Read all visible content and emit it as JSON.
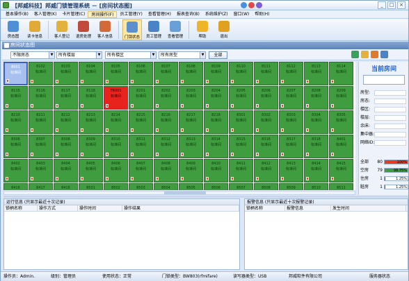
{
  "window": {
    "title": "【邦威科技】邦威门锁管理系统 － [房间状态图]"
  },
  "menu": {
    "items": [
      {
        "label": "基本操作(B)"
      },
      {
        "label": "客人管理(K)"
      },
      {
        "label": "卡片管理(C)"
      },
      {
        "label": "房间操作(F)"
      },
      {
        "label": "员工管理(Y)"
      },
      {
        "label": "查看管理(H)"
      },
      {
        "label": "报表查询(B)"
      },
      {
        "label": "系统维护(Z)"
      },
      {
        "label": "窗口(W)"
      },
      {
        "label": "帮助(H)"
      }
    ]
  },
  "toolbar": {
    "buttons": [
      {
        "label": "房态图",
        "icon": "room-map-icon",
        "color": "#4f8fd6"
      },
      {
        "label": "读卡信息",
        "icon": "card-read-icon",
        "color": "#e0a93a"
      },
      {
        "label": "客人登记",
        "icon": "guest-checkin-icon",
        "color": "#e3b23c"
      },
      {
        "label": "退房处理",
        "icon": "checkout-icon",
        "color": "#c24a3a"
      },
      {
        "label": "客人信息",
        "icon": "guest-info-icon",
        "color": "#d36a3a"
      },
      {
        "label": "门锁状态",
        "icon": "lock-status-icon",
        "color": "#5c8fce"
      },
      {
        "label": "员工管理",
        "icon": "staff-icon",
        "color": "#4a84c6"
      },
      {
        "label": "查看管理",
        "icon": "view-manage-icon",
        "color": "#6aa0d8"
      },
      {
        "label": "帮助",
        "icon": "help-icon",
        "color": "#f0b428"
      },
      {
        "label": "退出",
        "icon": "exit-icon",
        "color": "#e0a020"
      }
    ]
  },
  "panel": {
    "title": "房间状态图"
  },
  "filters": {
    "lock_type": "不限房态",
    "floor": "所有楼层",
    "building": "所有楼区",
    "room_type": "所有房型",
    "all_button": "全部"
  },
  "rooms": [
    {
      "no": "8001",
      "status": "标准间",
      "state": "selected"
    },
    {
      "no": "8102",
      "status": "标准间"
    },
    {
      "no": "8103",
      "status": "标准间"
    },
    {
      "no": "8104",
      "status": "标准间"
    },
    {
      "no": "8105",
      "status": "标准间"
    },
    {
      "no": "8106",
      "status": "标准间"
    },
    {
      "no": "8107",
      "status": "标准间"
    },
    {
      "no": "8108",
      "status": "标准间"
    },
    {
      "no": "8109",
      "status": "标准间"
    },
    {
      "no": "8110",
      "status": "标准间"
    },
    {
      "no": "8111",
      "status": "标准间"
    },
    {
      "no": "8112",
      "status": "标准间"
    },
    {
      "no": "8113",
      "status": "标准间"
    },
    {
      "no": "8114",
      "status": "标准间"
    },
    {
      "no": "8115",
      "status": "标准间"
    },
    {
      "no": "8116",
      "status": "标准间"
    },
    {
      "no": "8117",
      "status": "标准间"
    },
    {
      "no": "8118",
      "status": "标准间"
    },
    {
      "no": "TR001",
      "status": "标准间",
      "state": "locked"
    },
    {
      "no": "8201",
      "status": "标准间"
    },
    {
      "no": "8202",
      "status": "标准间"
    },
    {
      "no": "8203",
      "status": "标准间"
    },
    {
      "no": "8204",
      "status": "标准间"
    },
    {
      "no": "8205",
      "status": "标准间"
    },
    {
      "no": "8206",
      "status": "标准间"
    },
    {
      "no": "8207",
      "status": "标准间"
    },
    {
      "no": "8208",
      "status": "标准间"
    },
    {
      "no": "8209",
      "status": "标准间"
    },
    {
      "no": "8210",
      "status": "标准间"
    },
    {
      "no": "8211",
      "status": "标准间"
    },
    {
      "no": "8212",
      "status": "标准间"
    },
    {
      "no": "8213",
      "status": "标准间"
    },
    {
      "no": "8214",
      "status": "标准间"
    },
    {
      "no": "8215",
      "status": "标准间"
    },
    {
      "no": "8216",
      "status": "标准间"
    },
    {
      "no": "8217",
      "status": "标准间"
    },
    {
      "no": "8218",
      "status": "标准间"
    },
    {
      "no": "8301",
      "status": "标准间"
    },
    {
      "no": "8302",
      "status": "标准间"
    },
    {
      "no": "8303",
      "status": "标准间"
    },
    {
      "no": "8304",
      "status": "标准间"
    },
    {
      "no": "8305",
      "status": "标准间"
    },
    {
      "no": "8306",
      "status": "标准间"
    },
    {
      "no": "8307",
      "status": "标准间"
    },
    {
      "no": "8308",
      "status": "标准间"
    },
    {
      "no": "8309",
      "status": "标准间"
    },
    {
      "no": "8310",
      "status": "标准间"
    },
    {
      "no": "8311",
      "status": "标准间"
    },
    {
      "no": "8312",
      "status": "标准间"
    },
    {
      "no": "8313",
      "status": "标准间"
    },
    {
      "no": "8314",
      "status": "标准间"
    },
    {
      "no": "8315",
      "status": "标准间"
    },
    {
      "no": "8316",
      "status": "标准间"
    },
    {
      "no": "8317",
      "status": "标准间"
    },
    {
      "no": "8318",
      "status": "标准间"
    },
    {
      "no": "8401",
      "status": "标准间"
    },
    {
      "no": "8402",
      "status": "标准间"
    },
    {
      "no": "8403",
      "status": "标准间"
    },
    {
      "no": "8404",
      "status": "标准间"
    },
    {
      "no": "8405",
      "status": "标准间"
    },
    {
      "no": "8406",
      "status": "标准间"
    },
    {
      "no": "8407",
      "status": "标准间"
    },
    {
      "no": "8408",
      "status": "标准间"
    },
    {
      "no": "8409",
      "status": "标准间"
    },
    {
      "no": "8410",
      "status": "标准间"
    },
    {
      "no": "8411",
      "status": "标准间"
    },
    {
      "no": "8412",
      "status": "标准间"
    },
    {
      "no": "8413",
      "status": "标准间"
    },
    {
      "no": "8414",
      "status": "标准间"
    },
    {
      "no": "8415",
      "status": "标准间"
    },
    {
      "no": "8416",
      "status": "标准间"
    },
    {
      "no": "8417",
      "status": "标准间"
    },
    {
      "no": "8418",
      "status": "标准间"
    },
    {
      "no": "8501",
      "status": "标准间"
    },
    {
      "no": "8502",
      "status": "标准间"
    },
    {
      "no": "8503",
      "status": "标准间"
    },
    {
      "no": "8504",
      "status": "标准间"
    },
    {
      "no": "8505",
      "status": "标准间"
    },
    {
      "no": "8506",
      "status": "标准间"
    },
    {
      "no": "8507",
      "status": "标准间"
    },
    {
      "no": "8508",
      "status": "标准间"
    },
    {
      "no": "8509",
      "status": "标准间"
    },
    {
      "no": "8510",
      "status": "标准间"
    },
    {
      "no": "8511",
      "status": "标准间"
    }
  ],
  "current_room": {
    "title": "当前房间",
    "fields": [
      {
        "label": "房型:"
      },
      {
        "label": "房态:"
      },
      {
        "label": "楼区:"
      },
      {
        "label": "楼层:"
      },
      {
        "label": "余床:"
      },
      {
        "label": "集中器:"
      },
      {
        "label": "网络ID:"
      }
    ],
    "stats": [
      {
        "label": "全部",
        "count": "80",
        "percent": "100%",
        "fraction": 1.0,
        "color": "#e53d1f"
      },
      {
        "label": "空房",
        "count": "79",
        "percent": "98.75%",
        "fraction": 0.9875,
        "color": "#3f9c3f"
      },
      {
        "label": "住房",
        "count": "1",
        "percent": "1.25%",
        "fraction": 0.0125,
        "color": "#2a56c6"
      },
      {
        "label": "脏房",
        "count": "1",
        "percent": "1.25%",
        "fraction": 0.0125,
        "color": "#666666"
      }
    ]
  },
  "run_log": {
    "title": "运行信息 (只显示最近十次记录)",
    "columns": [
      "锁柄名称",
      "操作方式",
      "操作时间",
      "操作结果"
    ]
  },
  "alarm_log": {
    "title": "报警信息 (只显示最近十次报警记录)",
    "columns": [
      "锁柄名称",
      "报警信息",
      "发生时间"
    ]
  },
  "status": {
    "operator": "操作员：Admin.",
    "level": "级别：管理员",
    "state": "使用状态：正常",
    "lock_type": "门锁类型：BW803(rfmifare)",
    "reader_type": "读写器类型：USB",
    "company": "邦威软件有限公司",
    "service": "服务器状态"
  }
}
